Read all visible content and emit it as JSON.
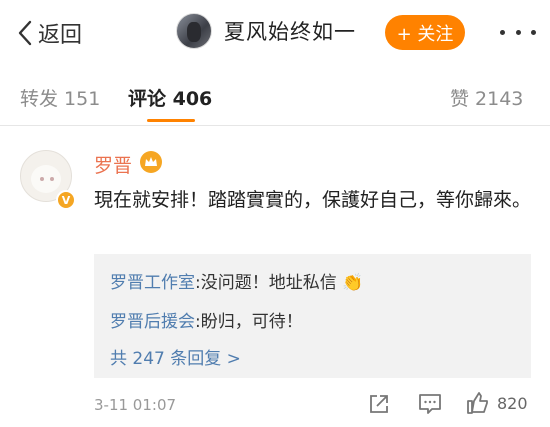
{
  "header": {
    "back_label": "返回",
    "username": "夏风始终如一",
    "follow_label": "+ 关注"
  },
  "tabs": [
    {
      "label": "转发 151"
    },
    {
      "label": "评论 406"
    },
    {
      "label": "赞 2143"
    }
  ],
  "comment": {
    "author": "罗晋",
    "text": "現在就安排！踏踏實實的，保護好自己，等你歸來。",
    "time": "3-11 01:07",
    "likes": "820",
    "replies": [
      {
        "name": "罗晋工作室",
        "text": ":没问题！地址私信 👏"
      },
      {
        "name": "罗晋后援会",
        "text": ":盼归，可待！"
      }
    ],
    "more_replies": "共 247 条回复 >"
  },
  "colors": {
    "accent": "#ff8200",
    "name": "#eb7350",
    "link": "#507daf"
  }
}
